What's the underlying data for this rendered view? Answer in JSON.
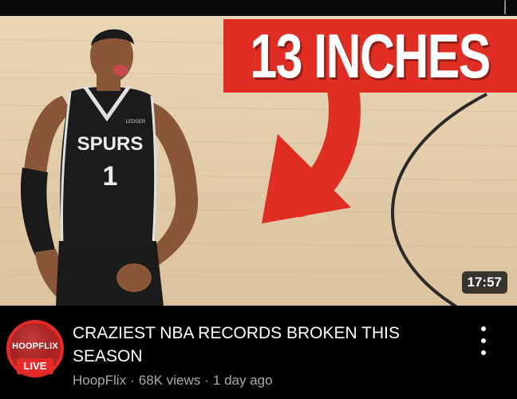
{
  "thumbnail": {
    "banner_text": "13 INCHES",
    "duration": "17:57",
    "jersey_team": "SPURS",
    "jersey_number": "1",
    "jersey_patch": "LEDGER"
  },
  "channel": {
    "avatar_text": "HOOPFLIX",
    "live_label": "LIVE"
  },
  "video": {
    "title": "CRAZIEST NBA RECORDS BROKEN THIS SEASON",
    "channel_name": "HoopFlix",
    "views": "68K views",
    "age": "1 day ago",
    "separator": "·"
  },
  "colors": {
    "accent_red": "#e12e24",
    "background": "#000000",
    "meta_gray": "#aaaaaa"
  },
  "icons": [
    "more-vert-icon",
    "arrow-graphic"
  ]
}
